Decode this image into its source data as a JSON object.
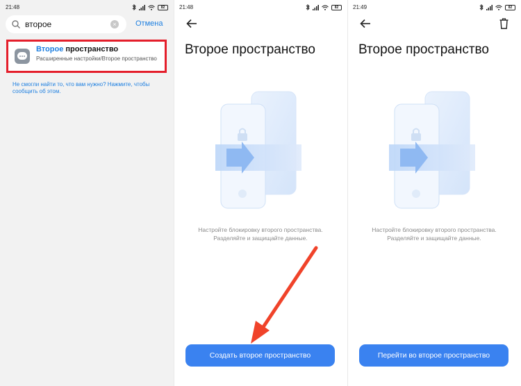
{
  "status_bar": {
    "panel1_time": "21:48",
    "panel2_time": "21:48",
    "panel3_time": "21:49",
    "battery": "82"
  },
  "search_screen": {
    "query": "второе",
    "cancel_label": "Отмена",
    "result": {
      "title_highlight": "Второе",
      "title_rest": "пространство",
      "subtitle": "Расширенные настройки/Второе пространство"
    },
    "hint": "Не смогли найти то, что вам нужно? Нажмите, чтобы сообщить об этом."
  },
  "create_screen": {
    "title": "Второе пространство",
    "description_line1": "Настройте блокировку второго пространства.",
    "description_line2": "Разделяйте и защищайте данные.",
    "button_label": "Создать второе пространство"
  },
  "existing_screen": {
    "title": "Второе пространство",
    "description_line1": "Настройте блокировку второго пространства.",
    "description_line2": "Разделяйте и защищайте данные.",
    "button_label": "Перейти во второе пространство"
  },
  "colors": {
    "accent": "#1d7fe0",
    "button": "#3a82f0",
    "highlight_frame": "#e41e2b",
    "annotation_arrow": "#f0432a"
  },
  "icons": [
    "search-icon",
    "clear-icon",
    "back-arrow-icon",
    "trash-icon",
    "bluetooth-icon",
    "signal-icon",
    "wifi-icon",
    "battery-icon"
  ]
}
